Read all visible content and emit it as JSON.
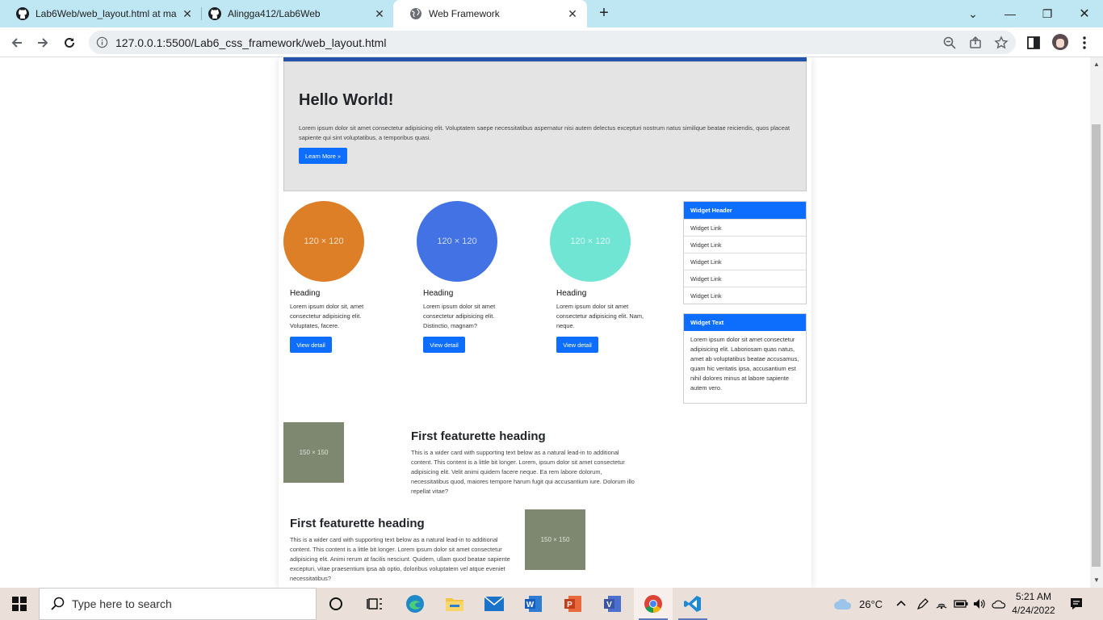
{
  "browser": {
    "tabs": [
      {
        "title": "Lab6Web/web_layout.html at ma",
        "icon": "github-icon",
        "active": false
      },
      {
        "title": "Alingga412/Lab6Web",
        "icon": "github-icon",
        "active": false
      },
      {
        "title": "Web Framework",
        "icon": "globe-icon",
        "active": true
      }
    ],
    "url": "127.0.0.1:5500/Lab6_css_framework/web_layout.html"
  },
  "page": {
    "jumbotron": {
      "heading": "Hello World!",
      "text": "Lorem ipsum dolor sit amet consectetur adipisicing elit. Voluptatem saepe necessitatibus aspernatur nisi autem delectus excepturi nostrum natus similique beatae reiciendis, quos placeat sapiente qui sint voluptatibus, a temporibus quasi.",
      "button": "Learn More »"
    },
    "cards": [
      {
        "image": "120 × 120",
        "color": "#dd7f27",
        "heading": "Heading",
        "text": "Lorem ipsum dolor sit, amet consectetur adipisicing elit. Voluptates, facere.",
        "button": "View detail"
      },
      {
        "image": "120 × 120",
        "color": "#4272e4",
        "heading": "Heading",
        "text": "Lorem ipsum dolor sit amet consectetur adipisicing elit. Distinctio, magnam?",
        "button": "View detail"
      },
      {
        "image": "120 × 120",
        "color": "#70e5d3",
        "heading": "Heading",
        "text": "Lorem ipsum dolor sit amet consectetur adipisicing elit. Nam, neque.",
        "button": "View detail"
      }
    ],
    "widget_links": {
      "header": "Widget Header",
      "links": [
        "Widget Link",
        "Widget Link",
        "Widget Link",
        "Widget Link",
        "Widget Link"
      ]
    },
    "widget_text": {
      "header": "Widget Text",
      "text": "Lorem ipsum dolor sit amet consectetur adipisicing elit. Laboriosam quas natus, amet ab voluptatibus beatae accusamus, quam hic veritatis ipsa, accusantium est nihil dolores minus at labore sapiente autem vero."
    },
    "featurettes": [
      {
        "image": "150 × 150",
        "heading": "First featurette heading",
        "text": "This is a wider card with supporting text below as a natural lead-in to additional content. This content is a little bit longer. Lorem, ipsum dolor sit amet consectetur adipisicing elit. Velit animi quidem facere neque. Ea rem labore dolorum, necessitatibus quod, maiores tempore harum fugit qui accusantium iure. Dolorum illo repellat vitae?"
      },
      {
        "image": "150 × 150",
        "heading": "First featurette heading",
        "text": "This is a wider card with supporting text below as a natural lead-in to additional content. This content is a little bit longer. Lorem ipsum dolor sit amet consectetur adipisicing elit. Animi rerum at facilis nesciunt. Quidem, ullam quod beatae sapiente excepturi, vitae praesentium ipsa ab optio, doloribus voluptatem vel atque eveniet necessitatibus?"
      }
    ]
  },
  "taskbar": {
    "search_placeholder": "Type here to search",
    "weather": "26°C",
    "time": "5:21 AM",
    "date": "4/24/2022"
  }
}
